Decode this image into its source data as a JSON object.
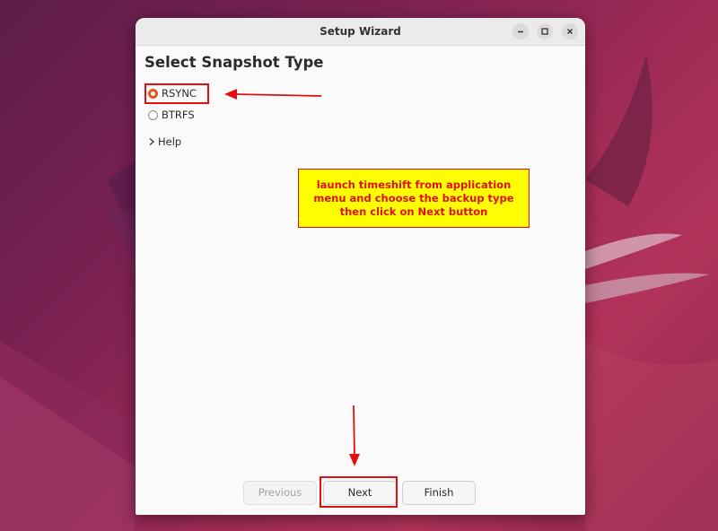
{
  "window": {
    "title": "Setup Wizard"
  },
  "page": {
    "title": "Select Snapshot Type"
  },
  "options": [
    {
      "label": "RSYNC",
      "checked": true
    },
    {
      "label": "BTRFS",
      "checked": false
    }
  ],
  "help": {
    "label": "Help"
  },
  "annotation": {
    "line1": "launch timeshift from application",
    "line2": "menu and choose the backup type",
    "line3": "then click on Next button"
  },
  "buttons": {
    "previous": "Previous",
    "next": "Next",
    "finish": "Finish"
  },
  "colors": {
    "accent": "#e95420",
    "annotation_red": "#e01010",
    "annotation_bg": "#ffff00"
  },
  "icons": [
    "minimize-icon",
    "maximize-icon",
    "close-icon",
    "chevron-right-icon",
    "arrow-left-icon",
    "arrow-down-icon"
  ]
}
